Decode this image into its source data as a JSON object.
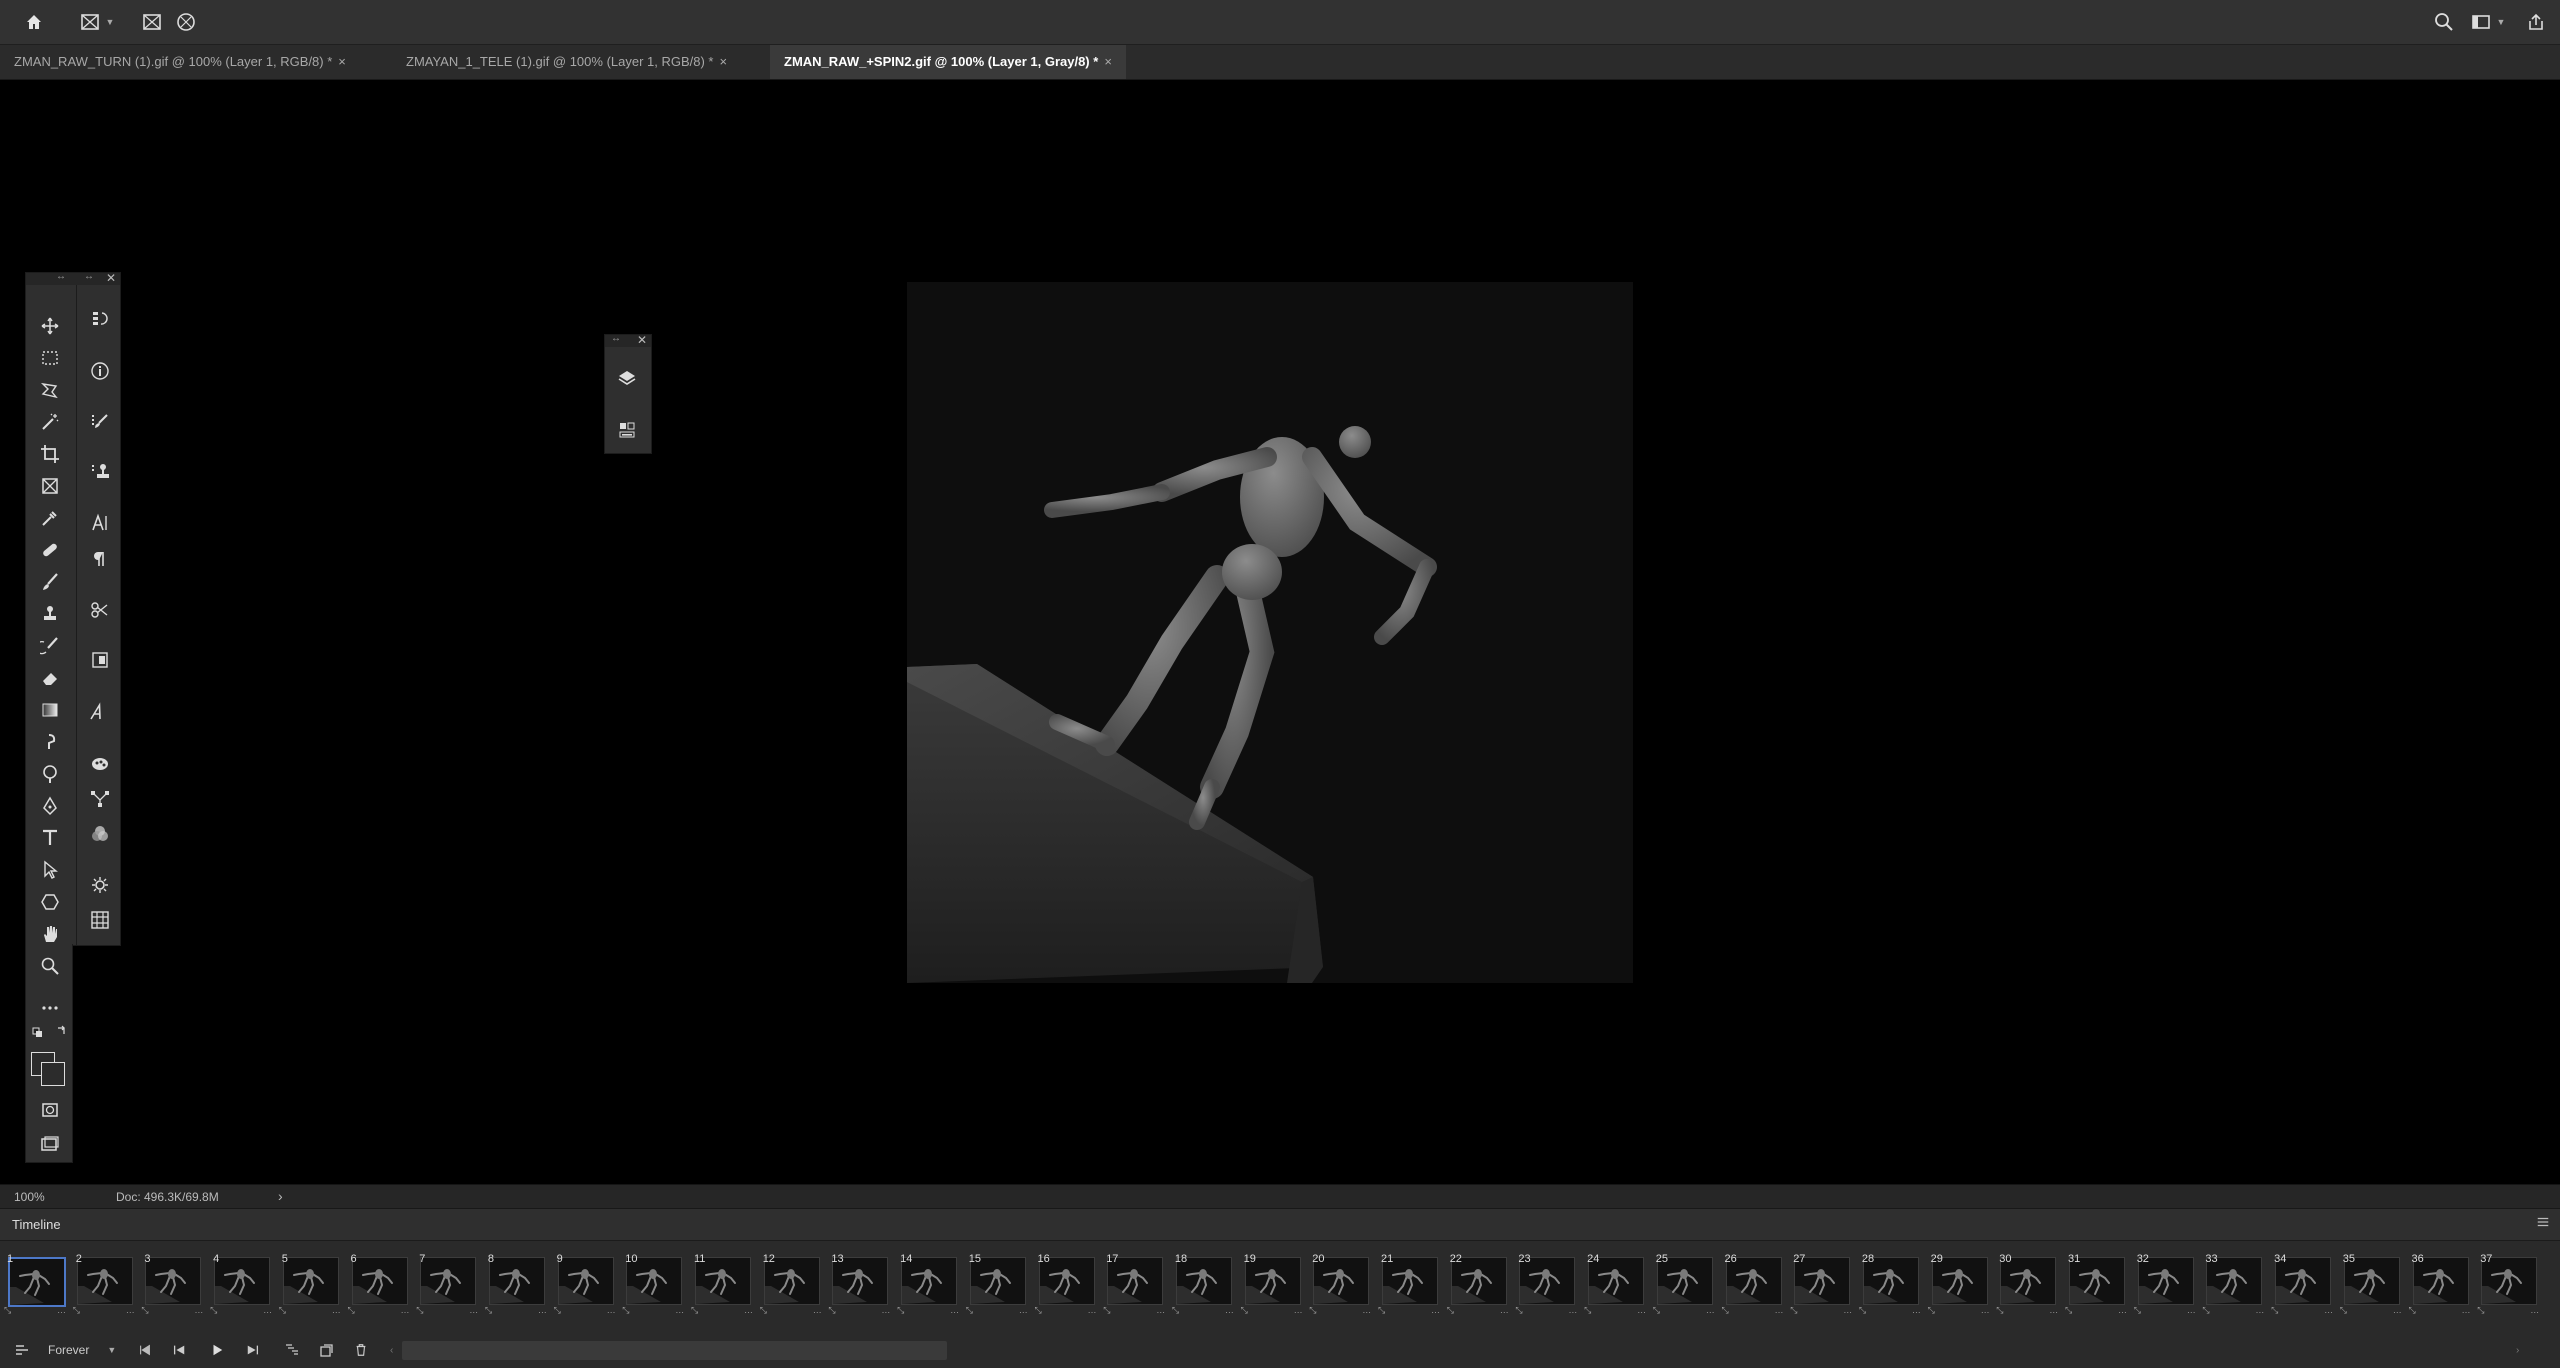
{
  "tabs": [
    {
      "label": "ZMAN_RAW_TURN (1).gif @ 100% (Layer 1, RGB/8) *",
      "active": false
    },
    {
      "label": "ZMAYAN_1_TELE (1).gif @ 100% (Layer 1, RGB/8) *",
      "active": false
    },
    {
      "label": "ZMAN_RAW_+SPIN2.gif @ 100% (Layer 1, Gray/8) *",
      "active": true
    }
  ],
  "tab_close_glyph": "×",
  "menubar": {
    "left_icons": [
      "home-icon",
      "frame-tool-icon",
      "frame-rect-icon",
      "frame-ellipse-icon"
    ],
    "right_icons": [
      "search-icon",
      "workspace-icon",
      "share-icon"
    ]
  },
  "status": {
    "zoom": "100%",
    "doc_info": "Doc: 496.3K/69.8M",
    "arrow": "›"
  },
  "timeline": {
    "title": "Timeline",
    "loop_option": "Forever",
    "frame_delay_glyph": "…",
    "frames": [
      "1",
      "2",
      "3",
      "4",
      "5",
      "6",
      "7",
      "8",
      "9",
      "10",
      "11",
      "12",
      "13",
      "14",
      "15",
      "16",
      "17",
      "18",
      "19",
      "20",
      "21",
      "22",
      "23",
      "24",
      "25",
      "26",
      "27",
      "28",
      "29",
      "30",
      "31",
      "32",
      "33",
      "34",
      "35",
      "36",
      "37"
    ],
    "selected_frame": "1"
  },
  "colors": {
    "app_bg": "#323232",
    "panel_bg": "#2f2f2f",
    "canvas_bg": "#000000",
    "selection": "#4d78c8"
  }
}
